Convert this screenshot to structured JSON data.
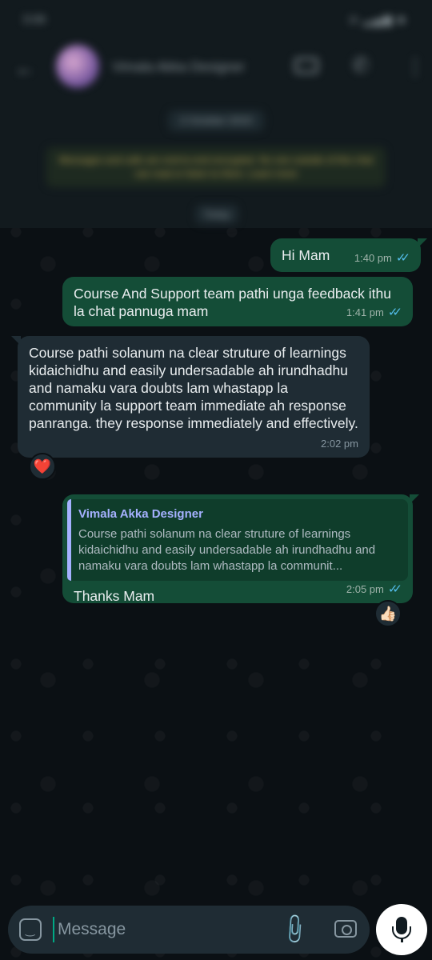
{
  "status": {
    "time": "3:06",
    "icons": "◘ ▂▄▆ ◙"
  },
  "header": {
    "contact_name": "Vimala Akka Designer",
    "back_icon": "arrow-left",
    "video_icon": "video-camera",
    "call_icon": "phone",
    "menu_icon": "more-vertical"
  },
  "system": {
    "date_chip": "2 October 2023",
    "encryption_notice": "Messages and calls are end-to-end encrypted. No one outside of this chat can read or listen to them. Learn more",
    "today_chip": "Today"
  },
  "messages": [
    {
      "direction": "out",
      "text": "Hi Mam",
      "time": "1:40 pm",
      "ticks": "✓✓"
    },
    {
      "direction": "out",
      "text": "Course And  Support team pathi unga feedback ithu la chat pannuga mam",
      "time": "1:41 pm",
      "ticks": "✓✓"
    },
    {
      "direction": "in",
      "text": "Course pathi solanum na clear struture of learnings kidaichidhu and easily undersadable ah irundhadhu and namaku vara doubts lam whastapp la community la support team immediate ah response panranga. they response immediately and effectively.",
      "time": "2:02 pm",
      "reaction": "❤️"
    },
    {
      "direction": "out",
      "quote_author": "Vimala Akka Designer",
      "quote_text": "Course pathi solanum na clear struture of learnings kidaichidhu and easily undersadable ah irundhadhu and namaku vara doubts lam whastapp la communit...",
      "text": "Thanks Mam",
      "time": "2:05 pm",
      "ticks": "✓✓",
      "reaction": "👍🏻"
    }
  ],
  "composer": {
    "placeholder": "Message"
  },
  "colors": {
    "outgoing_bubble": "#144d37",
    "incoming_bubble": "#1f2c34",
    "tick_read": "#53bdeb",
    "quote_accent": "#a5b1ff"
  }
}
